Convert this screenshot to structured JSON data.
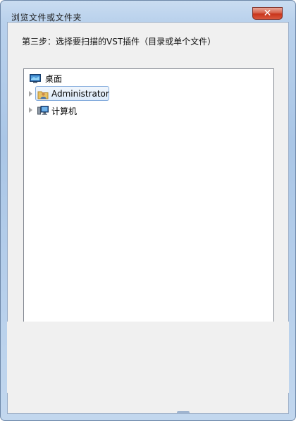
{
  "window": {
    "title": "浏览文件或文件夹",
    "close_label": "✕"
  },
  "dialog": {
    "instruction": "第三步：选择要扫描的VST插件（目录或单个文件）"
  },
  "tree": {
    "items": [
      {
        "label": "桌面",
        "icon": "desktop-icon",
        "expandable": false,
        "selected": false
      },
      {
        "label": "Administrator",
        "icon": "user-folder-icon",
        "expandable": true,
        "selected": true
      },
      {
        "label": "计算机",
        "icon": "computer-icon",
        "expandable": true,
        "selected": false
      }
    ]
  },
  "colors": {
    "frame": "#b9d1ec",
    "close_button": "#c8351c",
    "selection_border": "#84acdd",
    "client_bg": "#f0f0f0"
  }
}
